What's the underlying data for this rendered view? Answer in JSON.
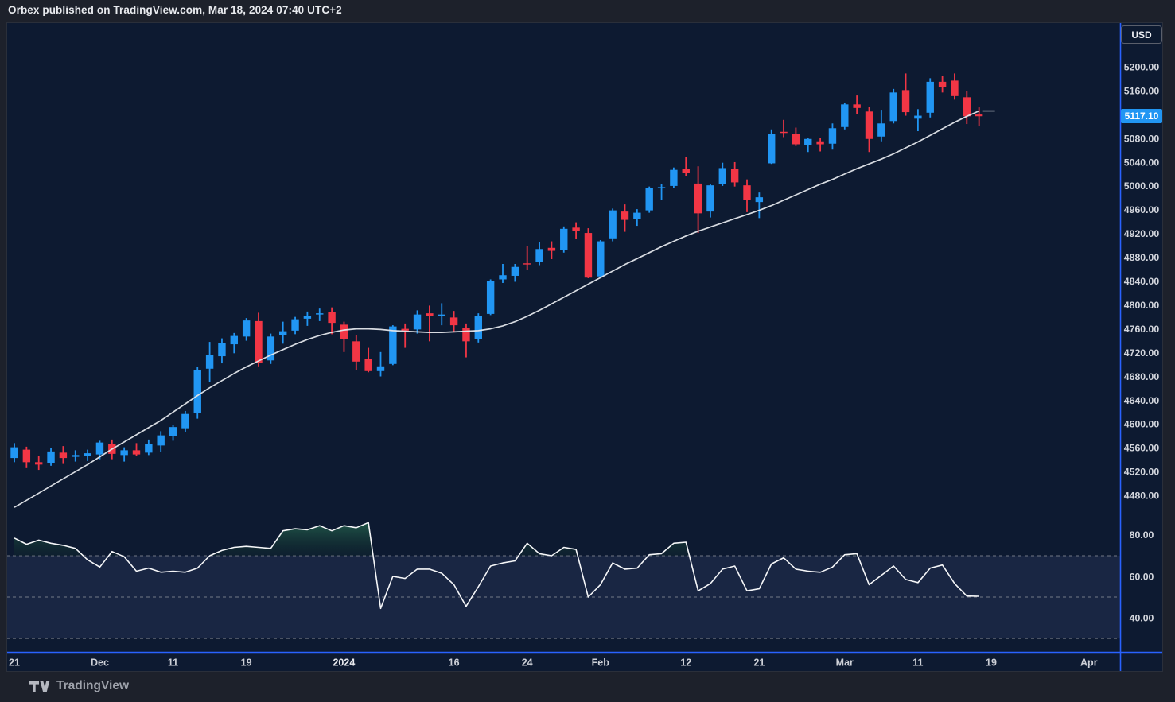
{
  "header": {
    "publish_text": "Orbex published on TradingView.com, Mar 18, 2024 07:40 UTC+2"
  },
  "toolbar": {
    "currency_button": "USD"
  },
  "footer": {
    "brand": "TradingView"
  },
  "price_axis": {
    "last_price_label": "5117.10",
    "tick_labels": [
      "5200.00",
      "5160.00",
      "5080.00",
      "5040.00",
      "5000.00",
      "4960.00",
      "4920.00",
      "4880.00",
      "4840.00",
      "4800.00",
      "4760.00",
      "4720.00",
      "4680.00",
      "4640.00",
      "4600.00",
      "4560.00",
      "4520.00",
      "4480.00"
    ]
  },
  "colors": {
    "up": "#2196F3",
    "down": "#F23645",
    "ma_line": "#E3E6EB",
    "ma_stub": "#9DA2AC",
    "rsi_line": "#F5F6F8",
    "overbought_fill_top": "#35926B",
    "overbought_fill_bottom": "#123528",
    "rsi_band": "rgba(99,110,177,0.14)",
    "level_dash": "#8A8E99",
    "frame_blue": "#2962FF",
    "badge_bg": "#2196F3",
    "pane_bg": "#0D1A31",
    "page_bg": "#1D212B",
    "widget_border": "#2A2F3A",
    "pane_separator": "#A7ABB4",
    "axis_text": "#D3D6DD",
    "time_text": "#CDD0D7",
    "time_text_bold": "#E9EBEF"
  },
  "chart_data": {
    "type": "candlestick",
    "title": "",
    "currency": "USD",
    "last_price": 5117.1,
    "price_scale": {
      "min": 4463,
      "max": 5275,
      "tick_step": 40,
      "first_tick": 4480,
      "last_tick": 5200
    },
    "time_ticks": [
      {
        "label": "21",
        "i": 0
      },
      {
        "label": "Dec",
        "i": 7
      },
      {
        "label": "11",
        "i": 13
      },
      {
        "label": "19",
        "i": 19
      },
      {
        "label": "2024",
        "i": 27,
        "bold": true
      },
      {
        "label": "16",
        "i": 36
      },
      {
        "label": "24",
        "i": 42
      },
      {
        "label": "Feb",
        "i": 48
      },
      {
        "label": "12",
        "i": 55
      },
      {
        "label": "21",
        "i": 61
      },
      {
        "label": "Mar",
        "i": 68
      },
      {
        "label": "11",
        "i": 74
      },
      {
        "label": "19",
        "i": 80
      },
      {
        "label": "Apr",
        "i": 88
      }
    ],
    "candles": [
      [
        "2023-11-21",
        4543,
        4568,
        4536,
        4561
      ],
      [
        "2023-11-22",
        4557,
        4562,
        4526,
        4536
      ],
      [
        "2023-11-24",
        4536,
        4546,
        4523,
        4532
      ],
      [
        "2023-11-27",
        4534,
        4560,
        4530,
        4554
      ],
      [
        "2023-11-28",
        4552,
        4563,
        4533,
        4543
      ],
      [
        "2023-11-29",
        4545,
        4556,
        4537,
        4548
      ],
      [
        "2023-11-30",
        4547,
        4557,
        4538,
        4551
      ],
      [
        "2023-12-01",
        4549,
        4572,
        4541,
        4569
      ],
      [
        "2023-12-04",
        4566,
        4574,
        4541,
        4550
      ],
      [
        "2023-12-05",
        4548,
        4561,
        4537,
        4556
      ],
      [
        "2023-12-06",
        4556,
        4568,
        4546,
        4549
      ],
      [
        "2023-12-07",
        4552,
        4574,
        4548,
        4567
      ],
      [
        "2023-12-08",
        4564,
        4588,
        4553,
        4581
      ],
      [
        "2023-12-11",
        4580,
        4599,
        4572,
        4595
      ],
      [
        "2023-12-12",
        4593,
        4622,
        4586,
        4617
      ],
      [
        "2023-12-13",
        4619,
        4696,
        4609,
        4691
      ],
      [
        "2023-12-14",
        4693,
        4738,
        4671,
        4716
      ],
      [
        "2023-12-15",
        4714,
        4744,
        4702,
        4736
      ],
      [
        "2023-12-18",
        4734,
        4753,
        4719,
        4748
      ],
      [
        "2023-12-19",
        4747,
        4778,
        4740,
        4774
      ],
      [
        "2023-12-20",
        4773,
        4787,
        4697,
        4703
      ],
      [
        "2023-12-21",
        4707,
        4752,
        4701,
        4747
      ],
      [
        "2023-12-22",
        4749,
        4772,
        4735,
        4756
      ],
      [
        "2023-12-26",
        4757,
        4780,
        4751,
        4776
      ],
      [
        "2023-12-27",
        4777,
        4789,
        4765,
        4782
      ],
      [
        "2023-12-28",
        4784,
        4794,
        4773,
        4786
      ],
      [
        "2023-12-29",
        4788,
        4796,
        4751,
        4770
      ],
      [
        "2024-01-02",
        4767,
        4772,
        4721,
        4743
      ],
      [
        "2024-01-03",
        4739,
        4749,
        4691,
        4705
      ],
      [
        "2024-01-04",
        4709,
        4728,
        4687,
        4689
      ],
      [
        "2024-01-05",
        4689,
        4721,
        4680,
        4697
      ],
      [
        "2024-01-08",
        4701,
        4766,
        4699,
        4764
      ],
      [
        "2024-01-09",
        4760,
        4769,
        4728,
        4757
      ],
      [
        "2024-01-10",
        4759,
        4791,
        4752,
        4784
      ],
      [
        "2024-01-11",
        4786,
        4799,
        4739,
        4781
      ],
      [
        "2024-01-12",
        4783,
        4803,
        4766,
        4784
      ],
      [
        "2024-01-16",
        4779,
        4790,
        4754,
        4766
      ],
      [
        "2024-01-17",
        4761,
        4769,
        4712,
        4739
      ],
      [
        "2024-01-18",
        4743,
        4786,
        4737,
        4781
      ],
      [
        "2024-01-19",
        4785,
        4843,
        4783,
        4840
      ],
      [
        "2024-01-22",
        4843,
        4869,
        4837,
        4850
      ],
      [
        "2024-01-23",
        4849,
        4869,
        4839,
        4864
      ],
      [
        "2024-01-24",
        4870,
        4899,
        4859,
        4869
      ],
      [
        "2024-01-25",
        4872,
        4906,
        4867,
        4894
      ],
      [
        "2024-01-26",
        4896,
        4907,
        4877,
        4891
      ],
      [
        "2024-01-29",
        4893,
        4932,
        4888,
        4928
      ],
      [
        "2024-01-30",
        4930,
        4939,
        4911,
        4925
      ],
      [
        "2024-01-31",
        4921,
        4929,
        4845,
        4846
      ],
      [
        "2024-02-01",
        4848,
        4909,
        4846,
        4907
      ],
      [
        "2024-02-02",
        4912,
        4962,
        4907,
        4959
      ],
      [
        "2024-02-05",
        4957,
        4969,
        4923,
        4943
      ],
      [
        "2024-02-06",
        4944,
        4961,
        4933,
        4955
      ],
      [
        "2024-02-07",
        4959,
        4999,
        4955,
        4996
      ],
      [
        "2024-02-08",
        4996,
        5003,
        4976,
        4998
      ],
      [
        "2024-02-09",
        5000,
        5031,
        4997,
        5027
      ],
      [
        "2024-02-12",
        5028,
        5049,
        5016,
        5022
      ],
      [
        "2024-02-13",
        5004,
        5033,
        4921,
        4954
      ],
      [
        "2024-02-14",
        4957,
        5003,
        4947,
        5001
      ],
      [
        "2024-02-15",
        5003,
        5039,
        5000,
        5030
      ],
      [
        "2024-02-16",
        5029,
        5040,
        4999,
        5006
      ],
      [
        "2024-02-20",
        5001,
        5011,
        4956,
        4976
      ],
      [
        "2024-02-21",
        4973,
        4989,
        4946,
        4981
      ],
      [
        "2024-02-22",
        5038,
        5095,
        5037,
        5088
      ],
      [
        "2024-02-23",
        5091,
        5111,
        5082,
        5089
      ],
      [
        "2024-02-26",
        5087,
        5098,
        5067,
        5070
      ],
      [
        "2024-02-27",
        5069,
        5081,
        5057,
        5079
      ],
      [
        "2024-02-28",
        5075,
        5081,
        5058,
        5070
      ],
      [
        "2024-02-29",
        5071,
        5105,
        5061,
        5097
      ],
      [
        "2024-03-01",
        5099,
        5140,
        5095,
        5137
      ],
      [
        "2024-03-04",
        5137,
        5152,
        5121,
        5131
      ],
      [
        "2024-03-05",
        5125,
        5133,
        5057,
        5079
      ],
      [
        "2024-03-06",
        5083,
        5128,
        5075,
        5105
      ],
      [
        "2024-03-07",
        5109,
        5163,
        5105,
        5157
      ],
      [
        "2024-03-08",
        5161,
        5189,
        5118,
        5124
      ],
      [
        "2024-03-11",
        5113,
        5129,
        5092,
        5118
      ],
      [
        "2024-03-12",
        5123,
        5181,
        5115,
        5175
      ],
      [
        "2024-03-13",
        5175,
        5185,
        5157,
        5166
      ],
      [
        "2024-03-14",
        5177,
        5189,
        5145,
        5151
      ],
      [
        "2024-03-15",
        5149,
        5159,
        5104,
        5117
      ],
      [
        "2024-03-18",
        5120,
        5132,
        5100,
        5117.1
      ]
    ],
    "ma20": [
      4460,
      4472,
      4484,
      4496,
      4508,
      4520,
      4532,
      4545,
      4558,
      4570,
      4582,
      4594,
      4606,
      4620,
      4634,
      4648,
      4661,
      4673,
      4685,
      4696,
      4706,
      4716,
      4725,
      4734,
      4742,
      4749,
      4754,
      4758,
      4760,
      4760,
      4759,
      4757,
      4756,
      4755,
      4754,
      4754,
      4755,
      4756,
      4757,
      4760,
      4765,
      4772,
      4781,
      4791,
      4802,
      4813,
      4824,
      4835,
      4846,
      4857,
      4868,
      4878,
      4888,
      4898,
      4907,
      4916,
      4924,
      4931,
      4938,
      4945,
      4952,
      4959,
      4967,
      4976,
      4985,
      4994,
      5003,
      5011,
      5020,
      5029,
      5037,
      5045,
      5054,
      5064,
      5074,
      5085,
      5096,
      5107,
      5117,
      5126
    ],
    "indicator": {
      "name": "RSI",
      "scale": {
        "min": 23.5,
        "max": 93.8
      },
      "axis_ticks": [
        80,
        60,
        40
      ],
      "levels": [
        70,
        50,
        30
      ],
      "values": [
        78.5,
        75.5,
        77.5,
        76,
        75,
        73.5,
        68,
        64.5,
        72,
        69.5,
        62.5,
        64,
        62,
        62.5,
        62,
        64,
        70,
        72.5,
        74,
        74.5,
        74,
        73.5,
        82,
        83,
        82.5,
        84.5,
        82,
        84.5,
        83.5,
        86,
        44.5,
        60,
        59,
        63.5,
        63.5,
        61.5,
        56,
        45.5,
        55,
        65,
        66.5,
        67.5,
        76,
        71,
        70,
        74,
        73,
        50,
        56,
        66.5,
        63.5,
        64,
        70.5,
        71,
        76,
        76.5,
        53,
        56.5,
        63.5,
        65,
        53,
        54,
        66,
        69,
        63.5,
        62.5,
        62,
        64.5,
        70.5,
        71,
        56,
        60.5,
        65,
        58.5,
        57,
        64,
        65.5,
        56.5,
        50.5,
        50.4
      ]
    }
  }
}
